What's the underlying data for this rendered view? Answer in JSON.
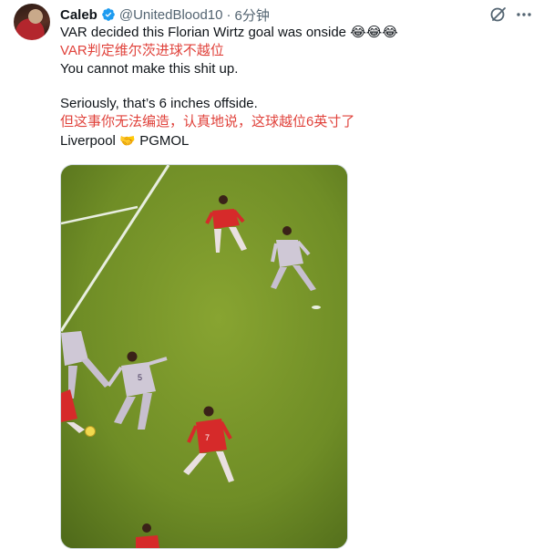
{
  "author": {
    "name": "Caleb",
    "handle": "@UnitedBlood10",
    "separator": "·",
    "time": "6分钟"
  },
  "icons": {
    "verified": "verified-badge-icon",
    "grok": "grok-icon",
    "more": "more-icon",
    "handshake": "handshake-emoji",
    "laugh": "tears-of-joy-emoji"
  },
  "colors": {
    "verified": "#1d9bf0",
    "translation_text": "#e0423b",
    "secondary_text": "#536471"
  },
  "post": {
    "line1": "VAR decided this Florian Wirtz goal was onside 😂😂😂",
    "line1_translation": "VAR判定维尔茨进球不越位",
    "line2": "You cannot make this shit up.",
    "line3": "Seriously, that’s 6 inches offside.",
    "line3_translation": "但这事你无法编造，认真地说，这球越位6英寸了",
    "line4_prefix": "Liverpool",
    "line4_emoji": "🤝",
    "line4_suffix": "PGMOL"
  }
}
